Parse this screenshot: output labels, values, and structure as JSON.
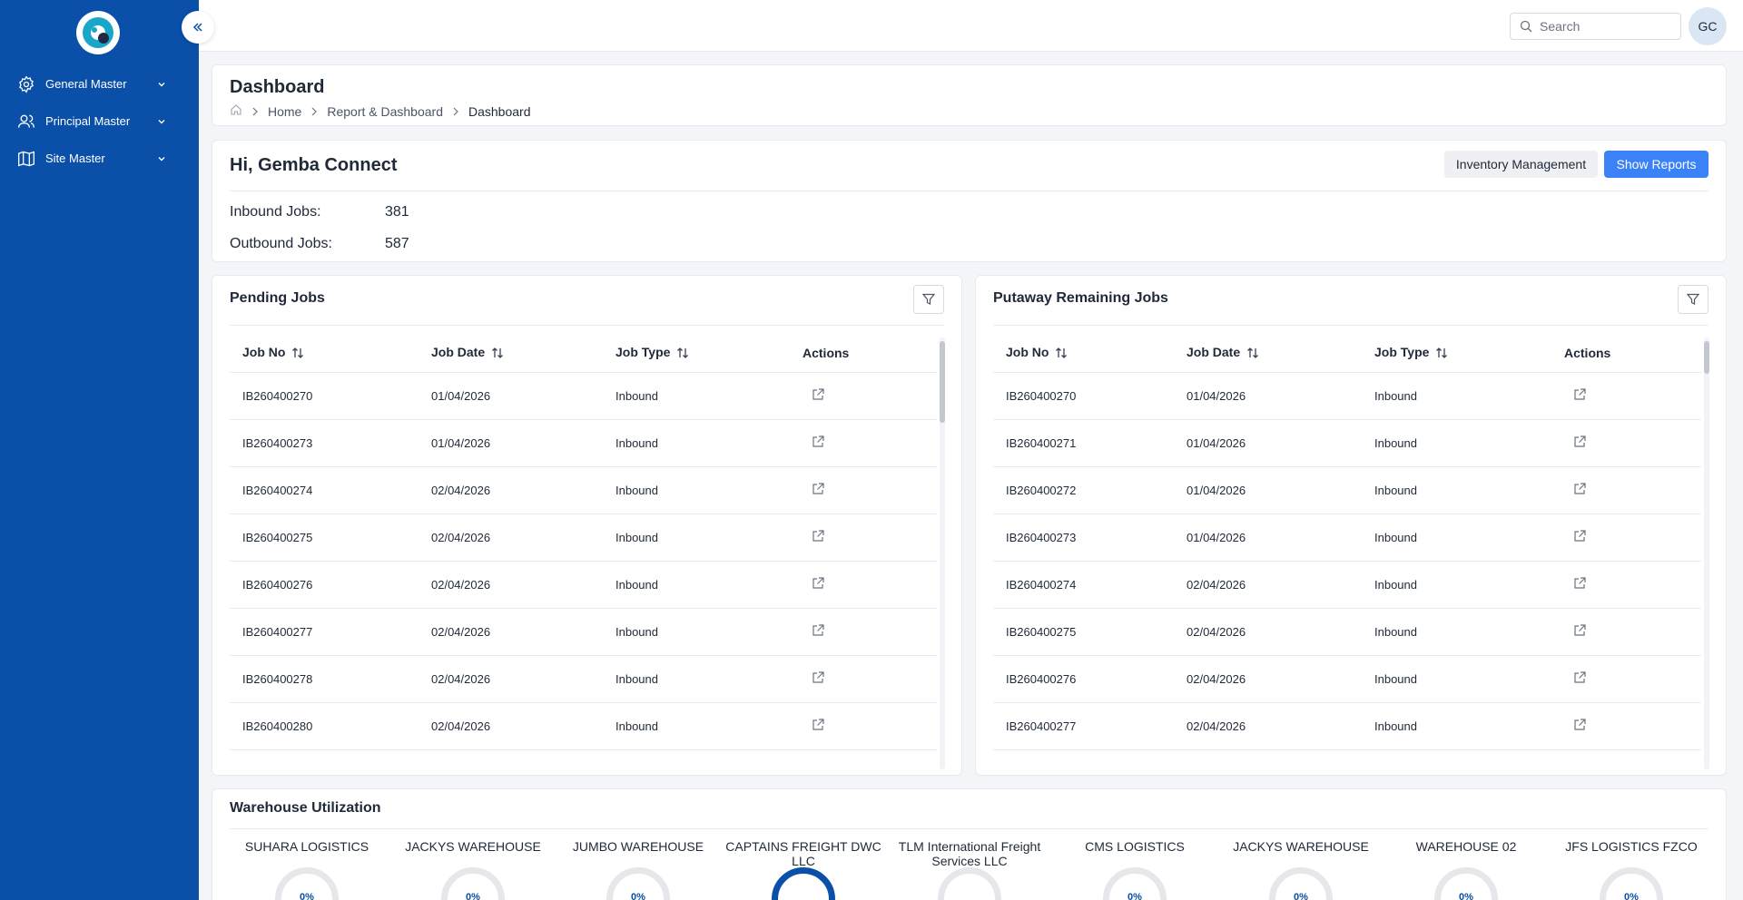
{
  "sidebar": {
    "items": [
      {
        "label": "General Master",
        "icon": "gear-icon"
      },
      {
        "label": "Principal Master",
        "icon": "users-icon"
      },
      {
        "label": "Site Master",
        "icon": "map-icon"
      }
    ]
  },
  "topbar": {
    "search_placeholder": "Search",
    "avatar_initials": "GC"
  },
  "header": {
    "title": "Dashboard",
    "breadcrumb": [
      "Home",
      "Report & Dashboard",
      "Dashboard"
    ]
  },
  "greeting": {
    "title": "Hi, Gemba Connect",
    "inventory_button": "Inventory Management",
    "reports_button": "Show Reports",
    "inbound_label": "Inbound Jobs:",
    "inbound_value": "381",
    "outbound_label": "Outbound Jobs:",
    "outbound_value": "587"
  },
  "pending_jobs": {
    "title": "Pending Jobs",
    "columns": [
      "Job No",
      "Job Date",
      "Job Type",
      "Actions"
    ],
    "rows": [
      [
        "IB260400270",
        "01/04/2026",
        "Inbound"
      ],
      [
        "IB260400273",
        "01/04/2026",
        "Inbound"
      ],
      [
        "IB260400274",
        "02/04/2026",
        "Inbound"
      ],
      [
        "IB260400275",
        "02/04/2026",
        "Inbound"
      ],
      [
        "IB260400276",
        "02/04/2026",
        "Inbound"
      ],
      [
        "IB260400277",
        "02/04/2026",
        "Inbound"
      ],
      [
        "IB260400278",
        "02/04/2026",
        "Inbound"
      ],
      [
        "IB260400280",
        "02/04/2026",
        "Inbound"
      ]
    ]
  },
  "putaway_jobs": {
    "title": "Putaway Remaining Jobs",
    "columns": [
      "Job No",
      "Job Date",
      "Job Type",
      "Actions"
    ],
    "rows": [
      [
        "IB260400270",
        "01/04/2026",
        "Inbound"
      ],
      [
        "IB260400271",
        "01/04/2026",
        "Inbound"
      ],
      [
        "IB260400272",
        "01/04/2026",
        "Inbound"
      ],
      [
        "IB260400273",
        "01/04/2026",
        "Inbound"
      ],
      [
        "IB260400274",
        "02/04/2026",
        "Inbound"
      ],
      [
        "IB260400275",
        "02/04/2026",
        "Inbound"
      ],
      [
        "IB260400276",
        "02/04/2026",
        "Inbound"
      ],
      [
        "IB260400277",
        "02/04/2026",
        "Inbound"
      ]
    ]
  },
  "warehouse_utilization": {
    "title": "Warehouse Utilization",
    "items": [
      {
        "name": "SUHARA LOGISTICS",
        "value": "0%"
      },
      {
        "name": "JACKYS WAREHOUSE",
        "value": "0%"
      },
      {
        "name": "JUMBO WAREHOUSE",
        "value": "0%"
      },
      {
        "name": "CAPTAINS FREIGHT DWC LLC",
        "value": ""
      },
      {
        "name": "TLM International Freight Services LLC",
        "value": ""
      },
      {
        "name": "CMS LOGISTICS",
        "value": "0%"
      },
      {
        "name": "JACKYS WAREHOUSE",
        "value": "0%"
      },
      {
        "name": "WAREHOUSE 02",
        "value": "0%"
      },
      {
        "name": "JFS LOGISTICS FZCO",
        "value": "0%"
      }
    ]
  },
  "colors": {
    "sidebar": "#0a4fa8",
    "primary": "#3b82f6"
  }
}
